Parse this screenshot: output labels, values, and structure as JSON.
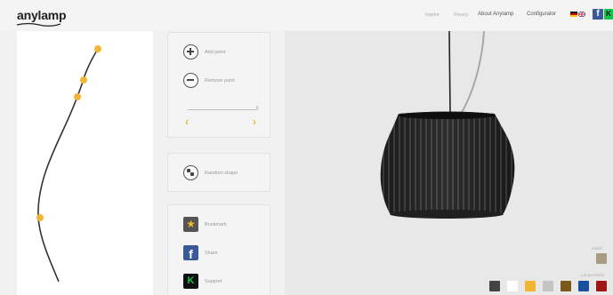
{
  "header": {
    "logo": "anylamp",
    "nav": {
      "imprint": "Imprint",
      "privacy": "Privacy",
      "about": "About Anylamp",
      "configurator": "Configurator"
    }
  },
  "controls": {
    "add_point_label": "Add point",
    "remove_point_label": "Remove point",
    "slider_value": "6",
    "random_shape_label": "Random shape",
    "bookmark_label": "Bookmark",
    "share_label": "Share",
    "support_label": "Support"
  },
  "colors": {
    "accent": "#f2b632",
    "lamp_swatches": [
      "#444444",
      "#ffffff",
      "#f2b632",
      "#c4c4c4",
      "#7a5a1a",
      "#1a4fa0",
      "#a01616"
    ],
    "cable_swatch": "#a89a80"
  },
  "icons": {
    "add": "plus-circle-icon",
    "remove": "minus-circle-icon",
    "random": "dice-icon",
    "bookmark": "star-icon",
    "share": "facebook-icon",
    "support": "kickstarter-icon"
  }
}
